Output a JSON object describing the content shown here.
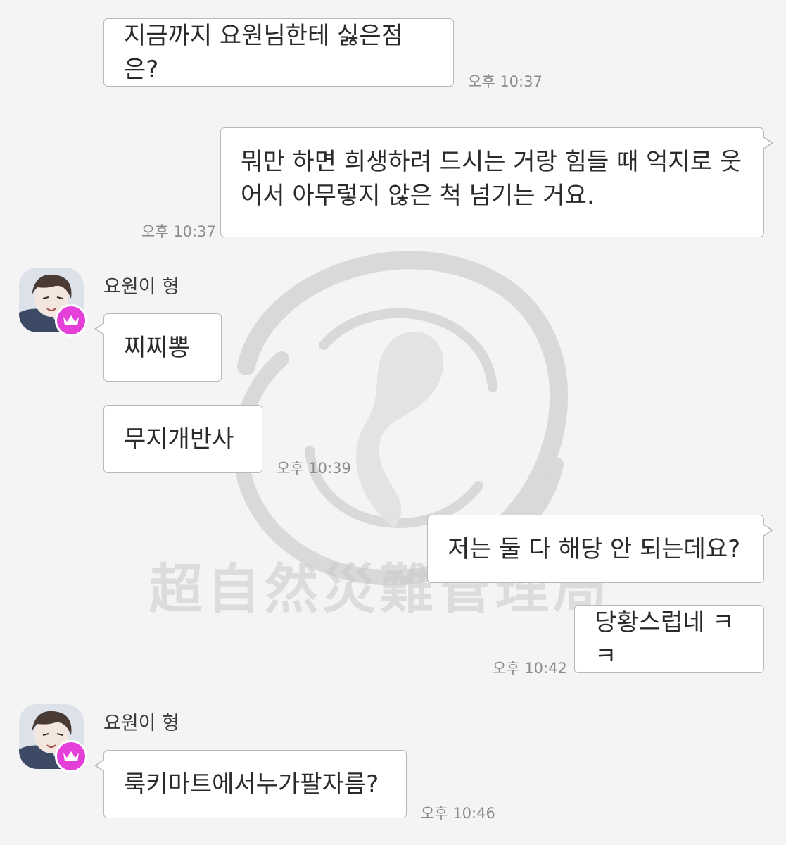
{
  "watermark": {
    "text": "超自然災難管理局"
  },
  "messages": [
    {
      "id": "m1",
      "text": "지금까지 요원님한테 싫은점은?",
      "time": "오후 10:37"
    },
    {
      "id": "m2",
      "text": "뭐만 하면 희생하려 드시는 거랑 힘들 때 억지로 웃어서 아무렇지 않은 척 넘기는 거요.",
      "time": "오후 10:37"
    },
    {
      "id": "m3",
      "sender": "요원이 형",
      "text": "찌찌뽕"
    },
    {
      "id": "m4",
      "text": "무지개반사",
      "time": "오후 10:39"
    },
    {
      "id": "m5",
      "text": "저는 둘 다 해당 안 되는데요?"
    },
    {
      "id": "m6",
      "text": "당황스럽네 ㅋㅋ",
      "time": "오후 10:42"
    },
    {
      "id": "m7",
      "sender": "요원이 형",
      "text": "룩키마트에서누가팔자름?",
      "time": "오후 10:46"
    }
  ],
  "icons": {
    "avatar": "avatar-illustration",
    "badge": "crown-icon"
  },
  "colors": {
    "badge": "#e43fd8",
    "background": "#f4f4f4",
    "bubble_border": "#b9b9b9"
  }
}
